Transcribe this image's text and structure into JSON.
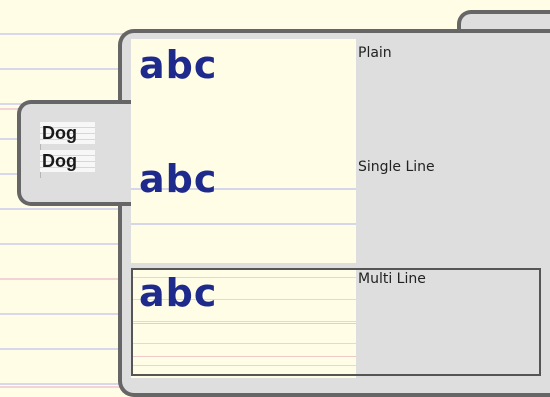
{
  "tab": {
    "items": [
      "Dog",
      "Dog"
    ]
  },
  "samples": [
    {
      "preview": "abc",
      "label": "Plain"
    },
    {
      "preview": "abc",
      "label": "Single Line"
    },
    {
      "preview": "abc",
      "label": "Multi Line"
    }
  ],
  "colors": {
    "paper": "#fffde6",
    "panel": "#dedede",
    "border": "#666666",
    "sample_text": "#1e2a8c",
    "line": "#d8d8ec",
    "pink_line": "#f3d3d3"
  }
}
